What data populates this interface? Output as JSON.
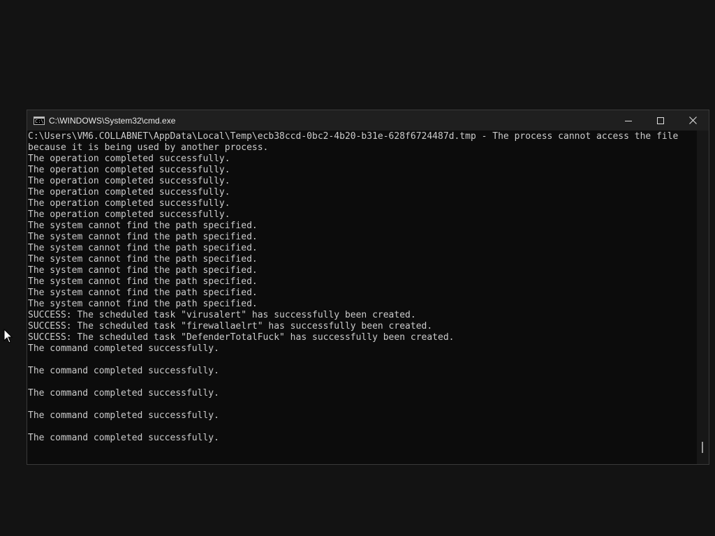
{
  "window": {
    "title": "C:\\WINDOWS\\System32\\cmd.exe",
    "icon": "cmd-console-icon",
    "icon_glyph": "C:\\",
    "controls": [
      "minimize-icon",
      "maximize-icon",
      "close-icon"
    ]
  },
  "console": {
    "lines": [
      "C:\\Users\\VM6.COLLABNET\\AppData\\Local\\Temp\\ecb38ccd-0bc2-4b20-b31e-628f6724487d.tmp - The process cannot access the file",
      "because it is being used by another process.",
      "The operation completed successfully.",
      "The operation completed successfully.",
      "The operation completed successfully.",
      "The operation completed successfully.",
      "The operation completed successfully.",
      "The operation completed successfully.",
      "The system cannot find the path specified.",
      "The system cannot find the path specified.",
      "The system cannot find the path specified.",
      "The system cannot find the path specified.",
      "The system cannot find the path specified.",
      "The system cannot find the path specified.",
      "The system cannot find the path specified.",
      "The system cannot find the path specified.",
      "SUCCESS: The scheduled task \"virusalert\" has successfully been created.",
      "SUCCESS: The scheduled task \"firewallaelrt\" has successfully been created.",
      "SUCCESS: The scheduled task \"DefenderTotalFuck\" has successfully been created.",
      "The command completed successfully.",
      "",
      "The command completed successfully.",
      "",
      "The command completed successfully.",
      "",
      "The command completed successfully.",
      "",
      "The command completed successfully."
    ]
  },
  "colors": {
    "background": "#131313",
    "console_bg": "#0c0c0c",
    "titlebar_bg": "#1f1f1f",
    "text": "#cccccc"
  }
}
